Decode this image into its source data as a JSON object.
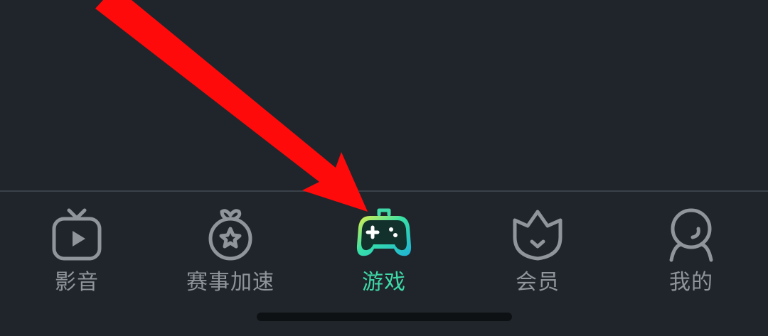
{
  "colors": {
    "background": "#1f252b",
    "divider": "#3a4148",
    "inactive": "#8f959b",
    "active": "#3fd8a7",
    "annotation": "#ff0a0a"
  },
  "tabbar": {
    "items": [
      {
        "label": "影音",
        "icon": "tv-play-icon",
        "active": false
      },
      {
        "label": "赛事加速",
        "icon": "medal-star-icon",
        "active": false
      },
      {
        "label": "游戏",
        "icon": "gamepad-icon",
        "active": true
      },
      {
        "label": "会员",
        "icon": "crown-icon",
        "active": false
      },
      {
        "label": "我的",
        "icon": "user-profile-icon",
        "active": false
      }
    ]
  }
}
